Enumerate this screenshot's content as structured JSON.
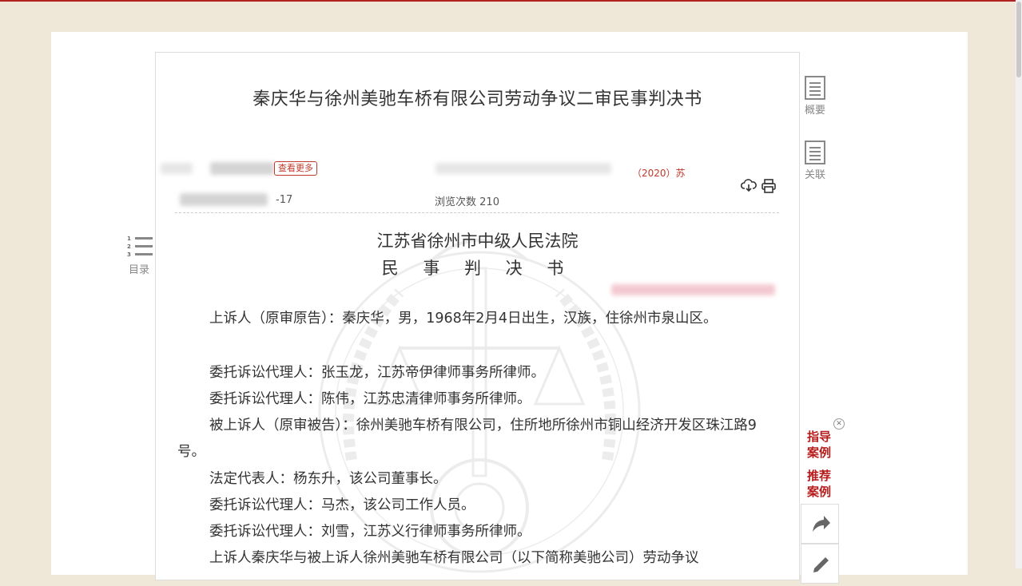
{
  "document": {
    "title": "秦庆华与徐州美驰车桥有限公司劳动争议二审民事判决书",
    "meta": {
      "more_badge": "查看更多",
      "case_no_red": "（2020）苏",
      "views_label": "浏览次数",
      "views_value": "210",
      "date_tail": "-17"
    },
    "court_name": "江苏省徐州市中级人民法院",
    "doc_type": "民 事 判 决 书",
    "paragraphs": [
      "上诉人（原审原告）：秦庆华，男，1968年2月4日出生，汉族，住徐州市泉山区。",
      "委托诉讼代理人：张玉龙，江苏帝伊律师事务所律师。",
      "委托诉讼代理人：陈伟，江苏忠清律师事务所律师。",
      "被上诉人（原审被告）：徐州美驰车桥有限公司，住所地所徐州市铜山经济开发区珠江路9号。",
      "法定代表人：杨东升，该公司董事长。",
      "委托诉讼代理人：马杰，该公司工作人员。",
      "委托诉讼代理人：刘雪，江苏义行律师事务所律师。",
      "上诉人秦庆华与被上诉人徐州美驰车桥有限公司（以下简称美驰公司）劳动争议"
    ]
  },
  "sidebar_right": {
    "summary_label": "概要",
    "related_label": "关联",
    "guide_cases": "指导案例",
    "recommended_cases": "推荐案例"
  },
  "sidebar_left": {
    "toc_label": "目录"
  },
  "colors": {
    "accent_red": "#b71c1c",
    "background": "#efe7d8"
  },
  "icons": {
    "download": "cloud-download-icon",
    "print": "printer-icon",
    "share": "share-icon",
    "edit": "pencil-icon"
  }
}
